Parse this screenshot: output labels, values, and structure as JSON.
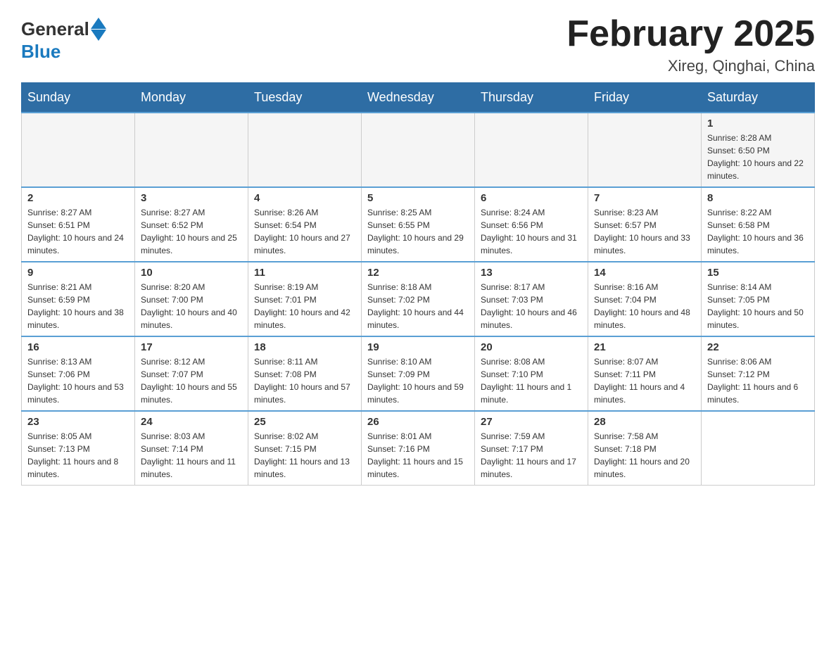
{
  "header": {
    "logo_general": "General",
    "logo_blue": "Blue",
    "title": "February 2025",
    "subtitle": "Xireg, Qinghai, China"
  },
  "weekdays": [
    "Sunday",
    "Monday",
    "Tuesday",
    "Wednesday",
    "Thursday",
    "Friday",
    "Saturday"
  ],
  "weeks": [
    [
      {
        "day": "",
        "info": ""
      },
      {
        "day": "",
        "info": ""
      },
      {
        "day": "",
        "info": ""
      },
      {
        "day": "",
        "info": ""
      },
      {
        "day": "",
        "info": ""
      },
      {
        "day": "",
        "info": ""
      },
      {
        "day": "1",
        "info": "Sunrise: 8:28 AM\nSunset: 6:50 PM\nDaylight: 10 hours and 22 minutes."
      }
    ],
    [
      {
        "day": "2",
        "info": "Sunrise: 8:27 AM\nSunset: 6:51 PM\nDaylight: 10 hours and 24 minutes."
      },
      {
        "day": "3",
        "info": "Sunrise: 8:27 AM\nSunset: 6:52 PM\nDaylight: 10 hours and 25 minutes."
      },
      {
        "day": "4",
        "info": "Sunrise: 8:26 AM\nSunset: 6:54 PM\nDaylight: 10 hours and 27 minutes."
      },
      {
        "day": "5",
        "info": "Sunrise: 8:25 AM\nSunset: 6:55 PM\nDaylight: 10 hours and 29 minutes."
      },
      {
        "day": "6",
        "info": "Sunrise: 8:24 AM\nSunset: 6:56 PM\nDaylight: 10 hours and 31 minutes."
      },
      {
        "day": "7",
        "info": "Sunrise: 8:23 AM\nSunset: 6:57 PM\nDaylight: 10 hours and 33 minutes."
      },
      {
        "day": "8",
        "info": "Sunrise: 8:22 AM\nSunset: 6:58 PM\nDaylight: 10 hours and 36 minutes."
      }
    ],
    [
      {
        "day": "9",
        "info": "Sunrise: 8:21 AM\nSunset: 6:59 PM\nDaylight: 10 hours and 38 minutes."
      },
      {
        "day": "10",
        "info": "Sunrise: 8:20 AM\nSunset: 7:00 PM\nDaylight: 10 hours and 40 minutes."
      },
      {
        "day": "11",
        "info": "Sunrise: 8:19 AM\nSunset: 7:01 PM\nDaylight: 10 hours and 42 minutes."
      },
      {
        "day": "12",
        "info": "Sunrise: 8:18 AM\nSunset: 7:02 PM\nDaylight: 10 hours and 44 minutes."
      },
      {
        "day": "13",
        "info": "Sunrise: 8:17 AM\nSunset: 7:03 PM\nDaylight: 10 hours and 46 minutes."
      },
      {
        "day": "14",
        "info": "Sunrise: 8:16 AM\nSunset: 7:04 PM\nDaylight: 10 hours and 48 minutes."
      },
      {
        "day": "15",
        "info": "Sunrise: 8:14 AM\nSunset: 7:05 PM\nDaylight: 10 hours and 50 minutes."
      }
    ],
    [
      {
        "day": "16",
        "info": "Sunrise: 8:13 AM\nSunset: 7:06 PM\nDaylight: 10 hours and 53 minutes."
      },
      {
        "day": "17",
        "info": "Sunrise: 8:12 AM\nSunset: 7:07 PM\nDaylight: 10 hours and 55 minutes."
      },
      {
        "day": "18",
        "info": "Sunrise: 8:11 AM\nSunset: 7:08 PM\nDaylight: 10 hours and 57 minutes."
      },
      {
        "day": "19",
        "info": "Sunrise: 8:10 AM\nSunset: 7:09 PM\nDaylight: 10 hours and 59 minutes."
      },
      {
        "day": "20",
        "info": "Sunrise: 8:08 AM\nSunset: 7:10 PM\nDaylight: 11 hours and 1 minute."
      },
      {
        "day": "21",
        "info": "Sunrise: 8:07 AM\nSunset: 7:11 PM\nDaylight: 11 hours and 4 minutes."
      },
      {
        "day": "22",
        "info": "Sunrise: 8:06 AM\nSunset: 7:12 PM\nDaylight: 11 hours and 6 minutes."
      }
    ],
    [
      {
        "day": "23",
        "info": "Sunrise: 8:05 AM\nSunset: 7:13 PM\nDaylight: 11 hours and 8 minutes."
      },
      {
        "day": "24",
        "info": "Sunrise: 8:03 AM\nSunset: 7:14 PM\nDaylight: 11 hours and 11 minutes."
      },
      {
        "day": "25",
        "info": "Sunrise: 8:02 AM\nSunset: 7:15 PM\nDaylight: 11 hours and 13 minutes."
      },
      {
        "day": "26",
        "info": "Sunrise: 8:01 AM\nSunset: 7:16 PM\nDaylight: 11 hours and 15 minutes."
      },
      {
        "day": "27",
        "info": "Sunrise: 7:59 AM\nSunset: 7:17 PM\nDaylight: 11 hours and 17 minutes."
      },
      {
        "day": "28",
        "info": "Sunrise: 7:58 AM\nSunset: 7:18 PM\nDaylight: 11 hours and 20 minutes."
      },
      {
        "day": "",
        "info": ""
      }
    ]
  ]
}
